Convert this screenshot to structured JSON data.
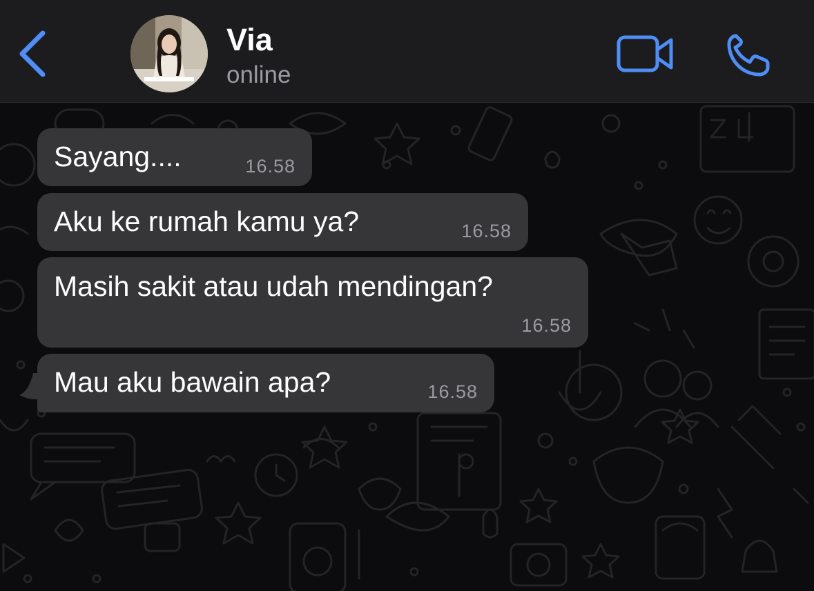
{
  "header": {
    "back_icon": "chevron-left-icon",
    "contact_name": "Via",
    "contact_status": "online",
    "video_icon": "video-camera-icon",
    "call_icon": "phone-icon",
    "accent_color": "#4f8ef7"
  },
  "chat": {
    "wallpaper": "doodle-pattern",
    "messages": [
      {
        "text": "Sayang....",
        "time": "16.58"
      },
      {
        "text": "Aku ke rumah kamu ya?",
        "time": "16.58"
      },
      {
        "text": "Masih sakit atau udah mendingan?",
        "time": "16.58"
      },
      {
        "text": "Mau aku bawain apa?",
        "time": "16.58"
      }
    ]
  }
}
